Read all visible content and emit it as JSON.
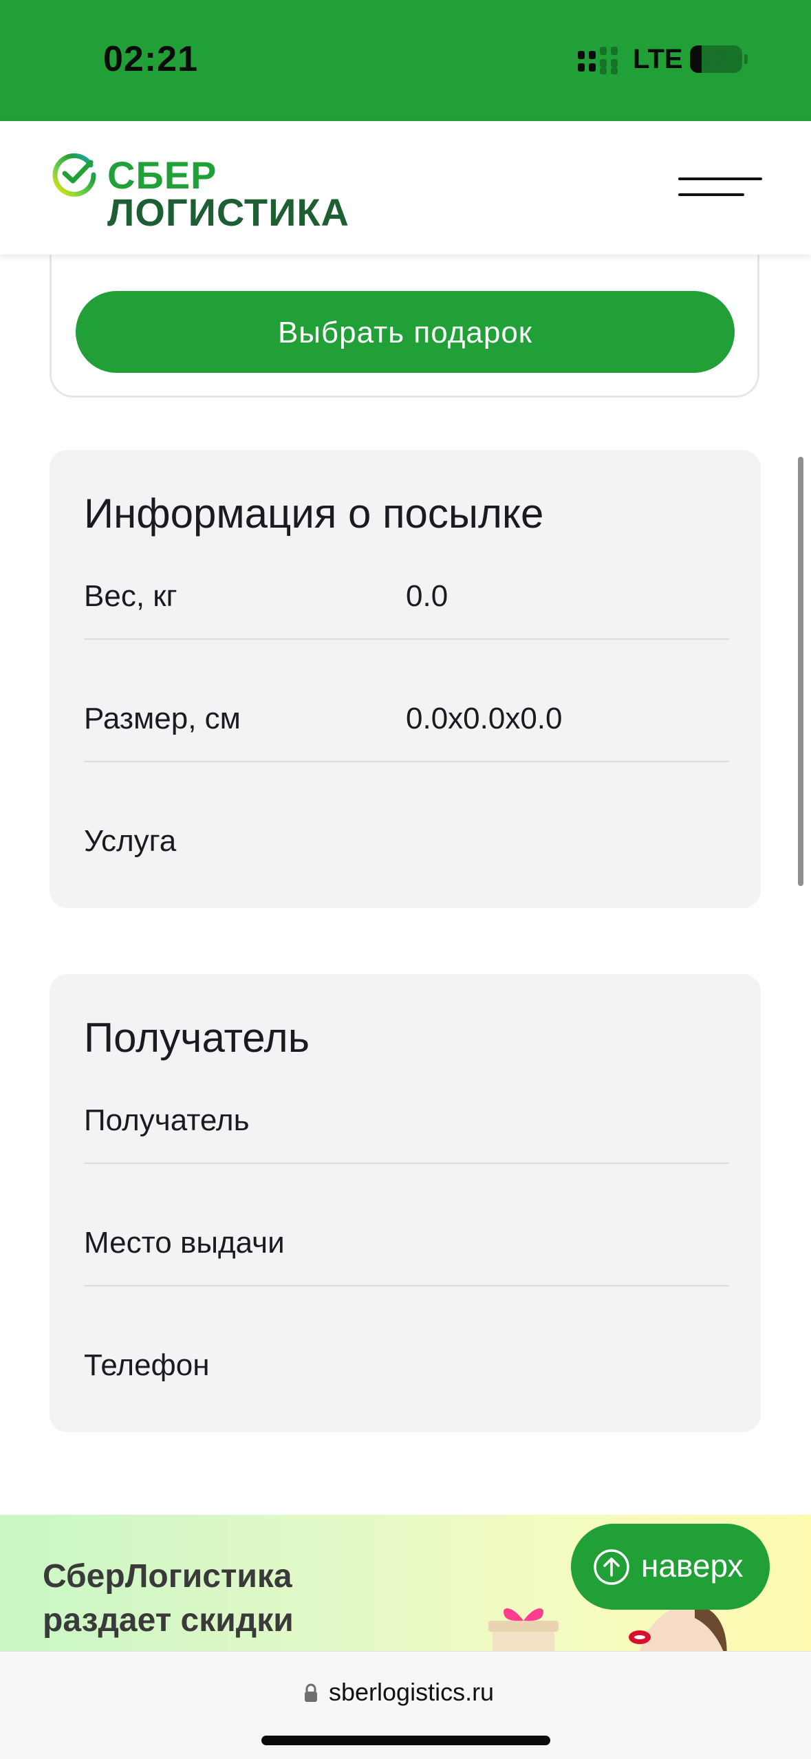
{
  "status_bar": {
    "time": "02:21",
    "network": "LTE",
    "battery": "22",
    "battery_level": 0.22
  },
  "header": {
    "logo_line1": "СБЕР",
    "logo_line2": "ЛОГИСТИКА",
    "menu_icon": "hamburger-menu-icon",
    "brand_color": "#21a038"
  },
  "gift": {
    "button_label": "Выбрать подарок"
  },
  "parcel_info": {
    "title": "Информация о посылке",
    "rows": [
      {
        "label": "Вес, кг",
        "value": "0.0"
      },
      {
        "label": "Размер, см",
        "value": "0.0x0.0x0.0"
      },
      {
        "label": "Услуга",
        "value": ""
      }
    ]
  },
  "recipient": {
    "title": "Получатель",
    "rows": [
      {
        "label": "Получатель",
        "value": ""
      },
      {
        "label": "Место выдачи",
        "value": ""
      },
      {
        "label": "Телефон",
        "value": ""
      }
    ]
  },
  "promo": {
    "line1": "СберЛогистика",
    "line2": "раздает скидки"
  },
  "to_top": {
    "label": "наверх",
    "icon": "arrow-up-circle-icon"
  },
  "browser": {
    "url": "sberlogistics.ru",
    "lock_icon": "lock-icon"
  }
}
